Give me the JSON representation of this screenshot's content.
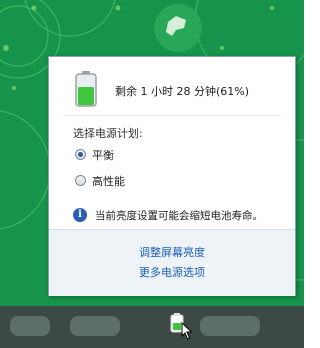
{
  "battery_popup": {
    "status_text": "剩余 1 小时 28 分钟(61%)",
    "charge_fraction": 0.61,
    "plan_header": "选择电源计划:",
    "plans": [
      {
        "label": "平衡",
        "selected": true
      },
      {
        "label": "高性能",
        "selected": false
      }
    ],
    "info_text": "当前亮度设置可能会缩短电池寿命。",
    "links": {
      "adjust_brightness": "调整屏幕亮度",
      "more_options": "更多电源选项"
    }
  },
  "taskbar": {
    "tray_icon": "battery-tray-icon"
  },
  "colors": {
    "desktop_green": "#16944c",
    "battery_fill": "#3fc63f",
    "link_blue": "#1d5fb8",
    "info_blue": "#2a5fb5"
  }
}
